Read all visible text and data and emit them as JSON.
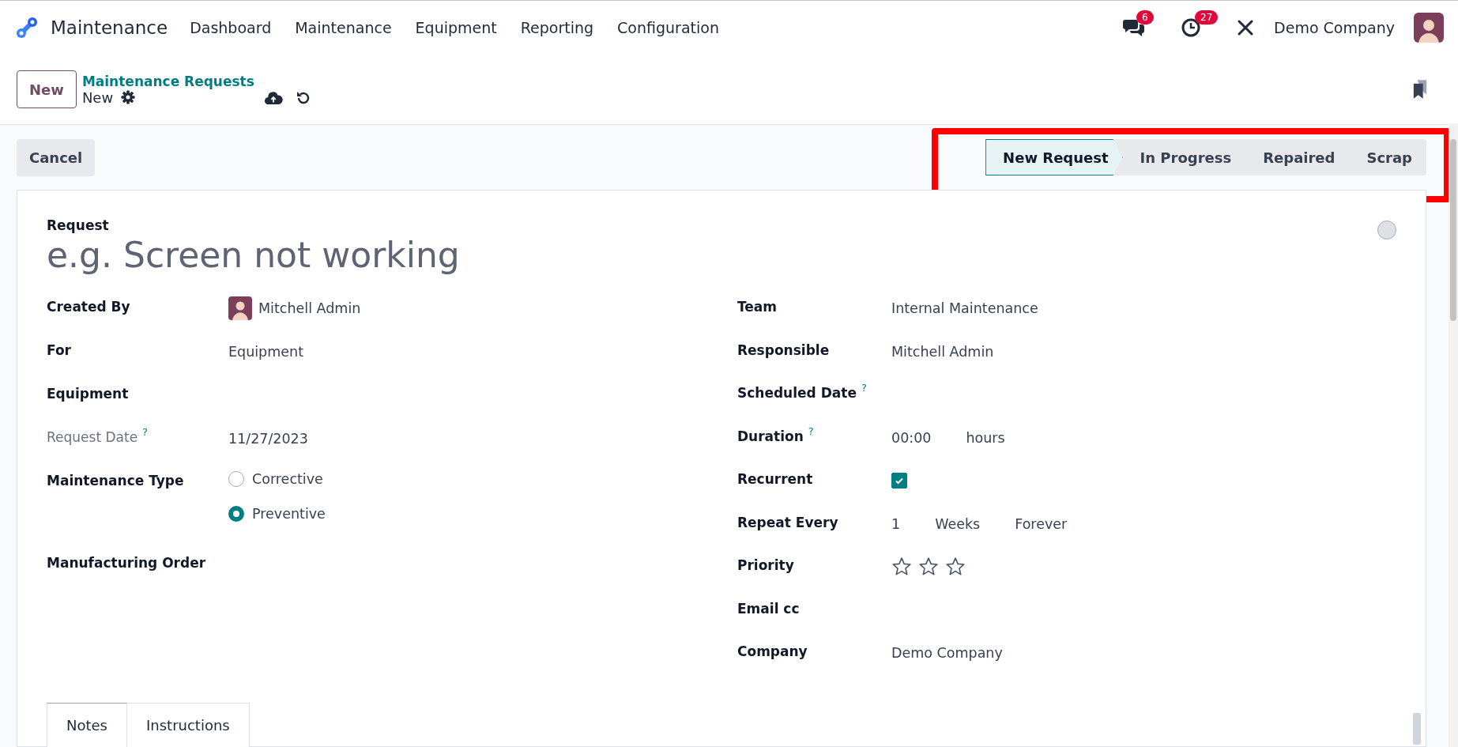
{
  "navbar": {
    "app_name": "Maintenance",
    "menu": [
      "Dashboard",
      "Maintenance",
      "Equipment",
      "Reporting",
      "Configuration"
    ],
    "messages_badge": "6",
    "activities_badge": "27",
    "company": "Demo Company"
  },
  "control_panel": {
    "new_button": "New",
    "breadcrumb": "Maintenance Requests",
    "record": "New"
  },
  "statusbar": {
    "cancel_button": "Cancel",
    "stages": [
      {
        "label": "New Request",
        "selected": true
      },
      {
        "label": "In Progress",
        "selected": false
      },
      {
        "label": "Repaired",
        "selected": false
      },
      {
        "label": "Scrap",
        "selected": false
      }
    ]
  },
  "form": {
    "title_label": "Request",
    "title_placeholder": "e.g. Screen not working",
    "fields_left": [
      {
        "label": "Created By",
        "kind": "user",
        "values": [
          "Mitchell Admin"
        ]
      },
      {
        "label": "For",
        "kind": "text",
        "values": [
          "Equipment"
        ]
      },
      {
        "label": "Equipment",
        "kind": "empty"
      },
      {
        "label": "Request Date",
        "kind": "text",
        "values": [
          "11/27/2023"
        ],
        "help": "?",
        "muted": true
      },
      {
        "label": "Maintenance Type",
        "kind": "radio",
        "options": [
          {
            "label": "Corrective",
            "selected": false
          },
          {
            "label": "Preventive",
            "selected": true
          }
        ]
      },
      {
        "label": "Manufacturing Order",
        "kind": "empty"
      }
    ],
    "fields_right": [
      {
        "label": "Team",
        "kind": "text",
        "values": [
          "Internal Maintenance"
        ]
      },
      {
        "label": "Responsible",
        "kind": "text",
        "values": [
          "Mitchell Admin"
        ]
      },
      {
        "label": "Scheduled Date",
        "kind": "empty",
        "help": "?"
      },
      {
        "label": "Duration",
        "kind": "text",
        "values": [
          "00:00",
          "hours"
        ],
        "help": "?"
      },
      {
        "label": "Recurrent",
        "kind": "checkbox",
        "checked": true
      },
      {
        "label": "Repeat Every",
        "kind": "text",
        "values": [
          "1",
          "Weeks",
          "Forever"
        ]
      },
      {
        "label": "Priority",
        "kind": "stars",
        "stars": 0
      },
      {
        "label": "Email cc",
        "kind": "empty"
      },
      {
        "label": "Company",
        "kind": "text",
        "values": [
          "Demo Company"
        ]
      }
    ],
    "tabs": [
      {
        "label": "Notes",
        "selected": true
      },
      {
        "label": "Instructions",
        "selected": false
      }
    ]
  }
}
